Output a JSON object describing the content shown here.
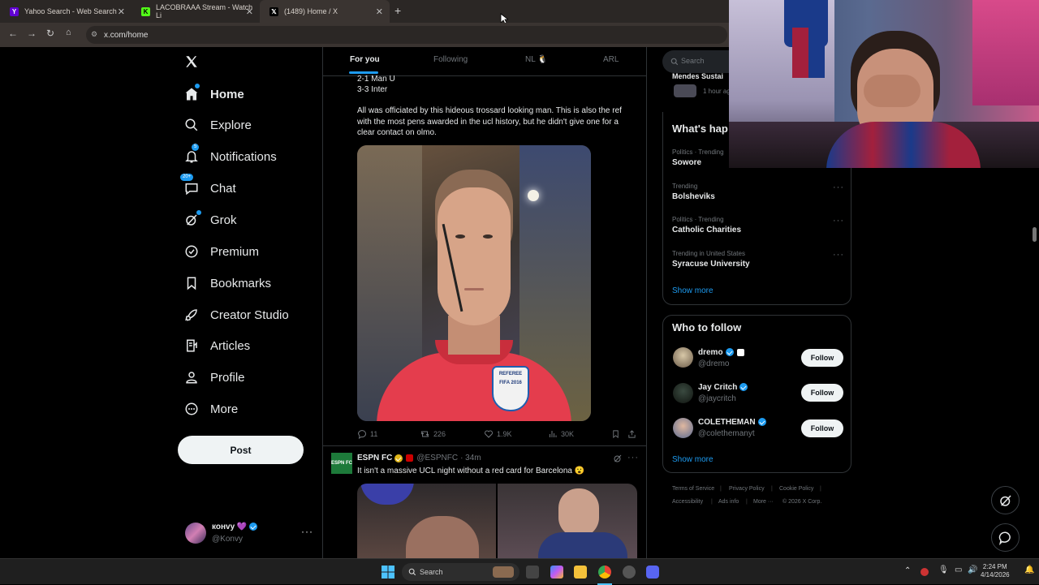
{
  "browser": {
    "tabs": [
      {
        "label": "Yahoo Search - Web Search",
        "icon": "yahoo-icon",
        "active": false
      },
      {
        "label": "LACOBRAAA Stream - Watch Li",
        "icon": "kick-icon",
        "active": false
      },
      {
        "label": "(1489) Home / X",
        "icon": "x-icon",
        "active": true
      }
    ],
    "url": "x.com/home"
  },
  "sidebar": {
    "items": [
      {
        "label": "Home",
        "icon": "home-icon"
      },
      {
        "label": "Explore",
        "icon": "search-icon"
      },
      {
        "label": "Notifications",
        "icon": "bell-icon",
        "badge": "5"
      },
      {
        "label": "Chat",
        "icon": "chat-icon",
        "badge": "20+"
      },
      {
        "label": "Grok",
        "icon": "grok-icon"
      },
      {
        "label": "Premium",
        "icon": "premium-icon"
      },
      {
        "label": "Bookmarks",
        "icon": "bookmark-icon"
      },
      {
        "label": "Creator Studio",
        "icon": "rocket-icon"
      },
      {
        "label": "Articles",
        "icon": "articles-icon"
      },
      {
        "label": "Profile",
        "icon": "person-icon"
      },
      {
        "label": "More",
        "icon": "more-circle-icon"
      }
    ],
    "post_label": "Post",
    "account": {
      "name": "конvy 💜",
      "handle": "@Konvy"
    }
  },
  "feed": {
    "tabs": [
      "For you",
      "Following",
      "NL 🐧",
      "ARL"
    ],
    "post1": {
      "lines": [
        "2-1 Man U",
        "3-3 Inter"
      ],
      "text": "All was officiated by this hideous trossard looking man. This is also the ref with the most pens awarded in the ucl history, but he didn't give one for a clear contact on olmo.",
      "image_badge": "REFEREE FIFA 2016",
      "replies": "11",
      "reposts": "226",
      "likes": "1.9K",
      "views": "30K"
    },
    "post2": {
      "author": "ESPN FC",
      "handle": "@ESPNFC",
      "time": "· 34m",
      "avatar_text": "ESPN FC",
      "text": "It isn't a massive UCL night without a red card for Barcelona 😮"
    }
  },
  "right": {
    "search_placeholder": "Search",
    "top_item": {
      "name": "Mendes Sustai",
      "time": "1 hour ag"
    },
    "trends_title": "What's hap",
    "trends": [
      {
        "context": "Politics · Trending",
        "name": "Sowore"
      },
      {
        "context": "Trending",
        "name": "Bolsheviks"
      },
      {
        "context": "Politics · Trending",
        "name": "Catholic Charities"
      },
      {
        "context": "Trending in United States",
        "name": "Syracuse University"
      }
    ],
    "show_more": "Show more",
    "who_to_follow_title": "Who to follow",
    "follow": [
      {
        "name": "dremo",
        "handle": "@dremo"
      },
      {
        "name": "Jay Critch",
        "handle": "@jaycritch"
      },
      {
        "name": "COLETHEMAN",
        "handle": "@colethemanyt"
      }
    ],
    "follow_label": "Follow",
    "footer": [
      "Terms of Service",
      "Privacy Policy",
      "Cookie Policy",
      "Accessibility",
      "Ads info",
      "More ···",
      "© 2026 X Corp."
    ]
  },
  "taskbar": {
    "search": "Search",
    "time": "2:24 PM",
    "date": "4/14/2026"
  },
  "colors": {
    "accent": "#1d9bf0",
    "jersey": "#e43d4d"
  }
}
